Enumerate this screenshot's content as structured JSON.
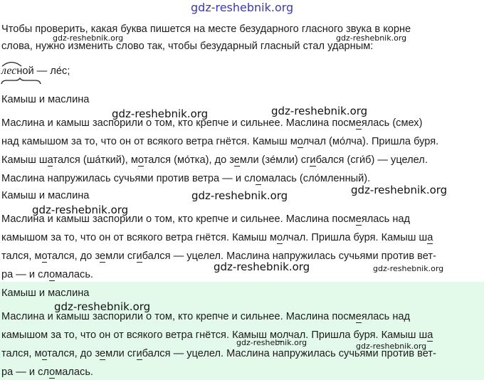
{
  "watermark": "gdz-reshebnik.org",
  "intro": {
    "line1": "Чтобы проверить, какая буква пишется на месте безударного гласного звука в корне",
    "line2": "слова, нужно изменить слово так, чтобы безударный гласный стал ударным:"
  },
  "example": {
    "root": "лес",
    "suffix": "ной",
    "dash": " — ",
    "check": "ле́с;"
  },
  "block1": {
    "title": "Камыш и маслина",
    "l1": "Маслина и камыш заспорили о том, кто крепче и сильнее. Маслина посм",
    "l1v": "е",
    "l1b": "ялась (смех)",
    "l2a": "над камышом за то, что он от всякого ветра гнётся. Камыш м",
    "l2v": "о",
    "l2b": "лчал (мо́лча). Пришла буря.",
    "l3a": "Камыш ш",
    "l3v1": "а",
    "l3b": "тался (ша́ткий), м",
    "l3v2": "о",
    "l3c": "тался (мо́тка), до з",
    "l3v3": "е",
    "l3d": "мли (зе́мли) сг",
    "l3v4": "и",
    "l3e": "бался (сги́б) — уцелел.",
    "l4a": "Маслина напружилась сучьями против ветра — и сл",
    "l4v": "о",
    "l4b": "малась (сло́мленный)."
  },
  "block2": {
    "title": "Камыш и маслина",
    "l1a": "Маслина и камыш заспорили о том, кто крепче и сильнее. Маслина посм",
    "l1v": "е",
    "l1b": "ялась над",
    "l2a": "камышом за то, что он от всякого ветра гнётся. Камыш м",
    "l2v": "о",
    "l2b": "лчал. Пришла буря. Камыш ш",
    "l2v2": "а",
    "l3a": "тался, м",
    "l3v1": "о",
    "l3b": "тался, до з",
    "l3v2": "е",
    "l3c": "мли сг",
    "l3v3": "и",
    "l3d": "бался — уцелел. Маслина напружилась сучьями против вет-",
    "l4a": "ра — и сл",
    "l4v": "о",
    "l4b": "малась."
  },
  "block3": {
    "title": "Камыш и маслина",
    "l1a": "Маслина и камыш заспорили о том, кто крепче и сильнее. Маслина посм",
    "l1v": "е",
    "l1b": "ялась над",
    "l2a": "камышом за то, что он от всякого ветра гнётся. Камыш м",
    "l2v": "о",
    "l2b": "лчал. Пришла буря. Камыш ш",
    "l2v2": "а",
    "l3a": "тался, м",
    "l3v1": "о",
    "l3b": "тался, до з",
    "l3v2": "е",
    "l3c": "мли сг",
    "l3v3": "и",
    "l3d": "бался — уцелел. Маслина напружилась сучьями против вет-",
    "l4a": "ра — и сл",
    "l4v": "о",
    "l4b": "малась."
  }
}
